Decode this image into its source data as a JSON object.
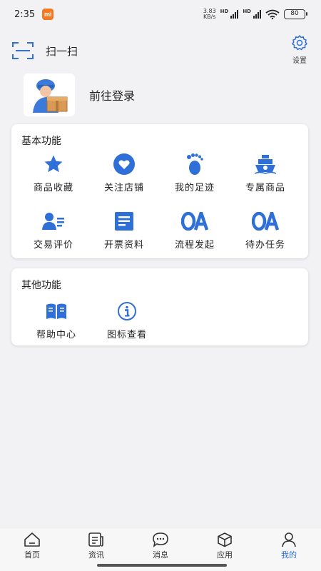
{
  "status": {
    "time": "2:35",
    "net_speed_value": "3.83",
    "net_speed_unit": "KB/s",
    "hd1": "HD",
    "hd2": "HD",
    "battery": "80"
  },
  "header": {
    "scan_label": "扫一扫",
    "settings_label": "设置"
  },
  "login": {
    "label": "前往登录"
  },
  "basic": {
    "title": "基本功能",
    "items": [
      {
        "label": "商品收藏",
        "icon": "star-icon"
      },
      {
        "label": "关注店铺",
        "icon": "heart-icon"
      },
      {
        "label": "我的足迹",
        "icon": "footprint-icon"
      },
      {
        "label": "专属商品",
        "icon": "ship-icon"
      },
      {
        "label": "交易评价",
        "icon": "user-card-icon"
      },
      {
        "label": "开票资料",
        "icon": "receipt-icon"
      },
      {
        "label": "流程发起",
        "icon": "oa-icon"
      },
      {
        "label": "待办任务",
        "icon": "oa-icon"
      }
    ]
  },
  "other": {
    "title": "其他功能",
    "items": [
      {
        "label": "帮助中心",
        "icon": "book-icon"
      },
      {
        "label": "图标查看",
        "icon": "info-icon"
      }
    ]
  },
  "tabs": [
    {
      "label": "首页",
      "icon": "home-icon"
    },
    {
      "label": "资讯",
      "icon": "news-icon"
    },
    {
      "label": "消息",
      "icon": "message-icon"
    },
    {
      "label": "应用",
      "icon": "cube-icon"
    },
    {
      "label": "我的",
      "icon": "profile-icon",
      "active": true
    }
  ],
  "colors": {
    "accent": "#2f6fd8",
    "icon_blue": "#2f6fd8",
    "background": "#f2f2f4"
  }
}
